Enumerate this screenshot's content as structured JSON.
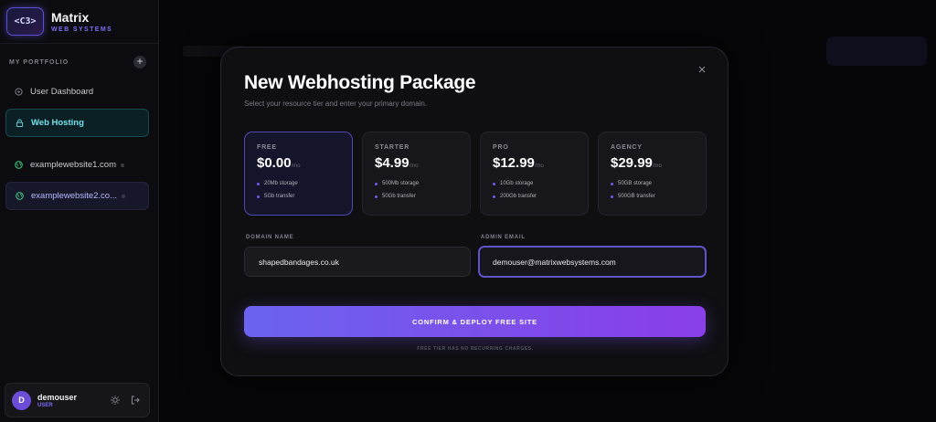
{
  "brand": {
    "logo_text": "<C3>",
    "name": "Matrix",
    "sub": "WEB SYSTEMS"
  },
  "sidebar": {
    "section_label": "MY PORTFOLIO",
    "add_symbol": "+",
    "items": [
      {
        "label": "User Dashboard",
        "icon": "gauge-icon"
      },
      {
        "label": "Web Hosting",
        "icon": "lock-icon",
        "active": true
      },
      {
        "label": "examplewebsite1.com",
        "icon": "globe-icon"
      },
      {
        "label": "examplewebsite2.co...",
        "icon": "globe-icon"
      }
    ]
  },
  "user": {
    "initial": "D",
    "name": "demouser",
    "role": "USER"
  },
  "modal": {
    "title": "New Webhosting Package",
    "subtitle": "Select your resource tier and enter your primary domain.",
    "close_symbol": "×",
    "tiers": [
      {
        "name": "FREE",
        "price": "$0.00",
        "per": "/mo",
        "features": [
          "20Mb storage",
          "5Gb transfer"
        ],
        "selected": true
      },
      {
        "name": "STARTER",
        "price": "$4.99",
        "per": "/mo",
        "features": [
          "500Mb storage",
          "50Gb transfer"
        ]
      },
      {
        "name": "PRO",
        "price": "$12.99",
        "per": "/mo",
        "features": [
          "10Gb storage",
          "200Gb transfer"
        ]
      },
      {
        "name": "AGENCY",
        "price": "$29.99",
        "per": "/mo",
        "features": [
          "50GB storage",
          "500GB transfer"
        ]
      }
    ],
    "domain_label": "DOMAIN NAME",
    "domain_value": "shapedbandages.co.uk",
    "email_label": "ADMIN EMAIL",
    "email_value": "demouser@matrixwebsystems.com",
    "cta_label": "CONFIRM & DEPLOY FREE SITE",
    "footnote": "FREE TIER HAS NO RECURRING CHARGES."
  },
  "colors": {
    "accent": "#6b63f0",
    "accent2": "#8a3ee6",
    "active_teal": "#6fe0e8"
  }
}
